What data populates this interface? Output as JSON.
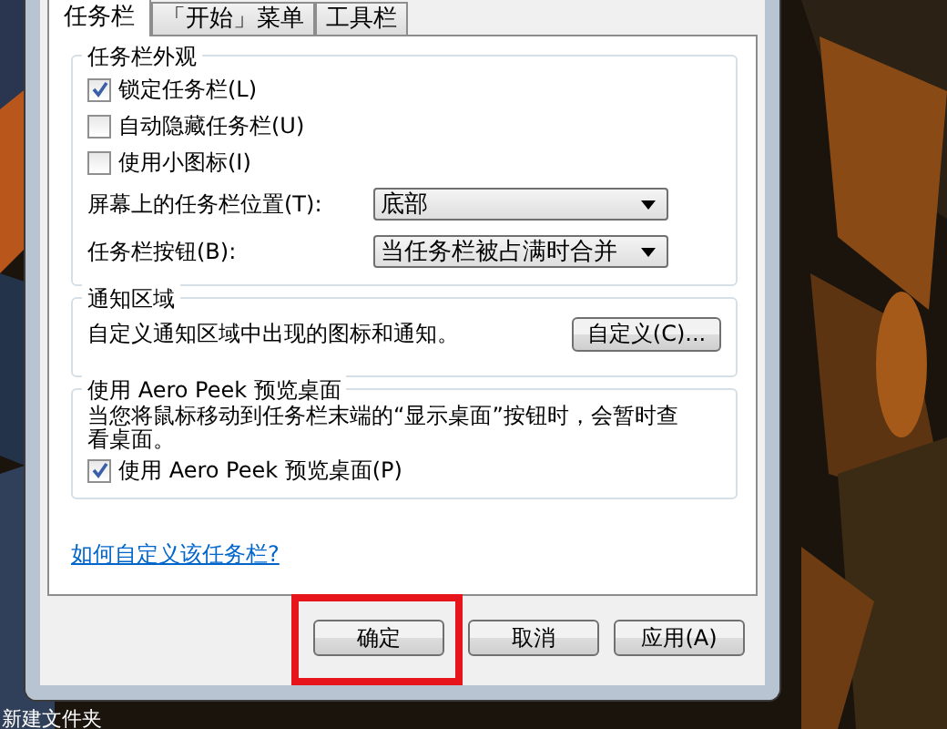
{
  "desktop": {
    "icon_labels": [
      "新建文件夹"
    ]
  },
  "tabs": [
    {
      "label": "任务栏",
      "selected": true
    },
    {
      "label": "「开始」菜单",
      "selected": false
    },
    {
      "label": "工具栏",
      "selected": false
    }
  ],
  "appearance": {
    "title": "任务栏外观",
    "options": [
      {
        "label": "锁定任务栏(L)",
        "checked": true
      },
      {
        "label": "自动隐藏任务栏(U)",
        "checked": false
      },
      {
        "label": "使用小图标(I)",
        "checked": false
      }
    ],
    "fields": [
      {
        "label": "屏幕上的任务栏位置(T):",
        "value": "底部"
      },
      {
        "label": "任务栏按钮(B):",
        "value": "当任务栏被占满时合并"
      }
    ]
  },
  "notification": {
    "title": "通知区域",
    "text": "自定义通知区域中出现的图标和通知。",
    "button": "自定义(C)..."
  },
  "aero_peek": {
    "title": "使用 Aero Peek 预览桌面",
    "text": "当您将鼠标移动到任务栏末端的“显示桌面”按钮时，会暂时查看桌面。",
    "option": {
      "label": "使用 Aero Peek 预览桌面(P)",
      "checked": true
    }
  },
  "help_link": "如何自定义该任务栏?",
  "buttons": [
    {
      "label": "确定",
      "highlighted": true
    },
    {
      "label": "取消",
      "highlighted": false
    },
    {
      "label": "应用(A)",
      "highlighted": false
    }
  ]
}
